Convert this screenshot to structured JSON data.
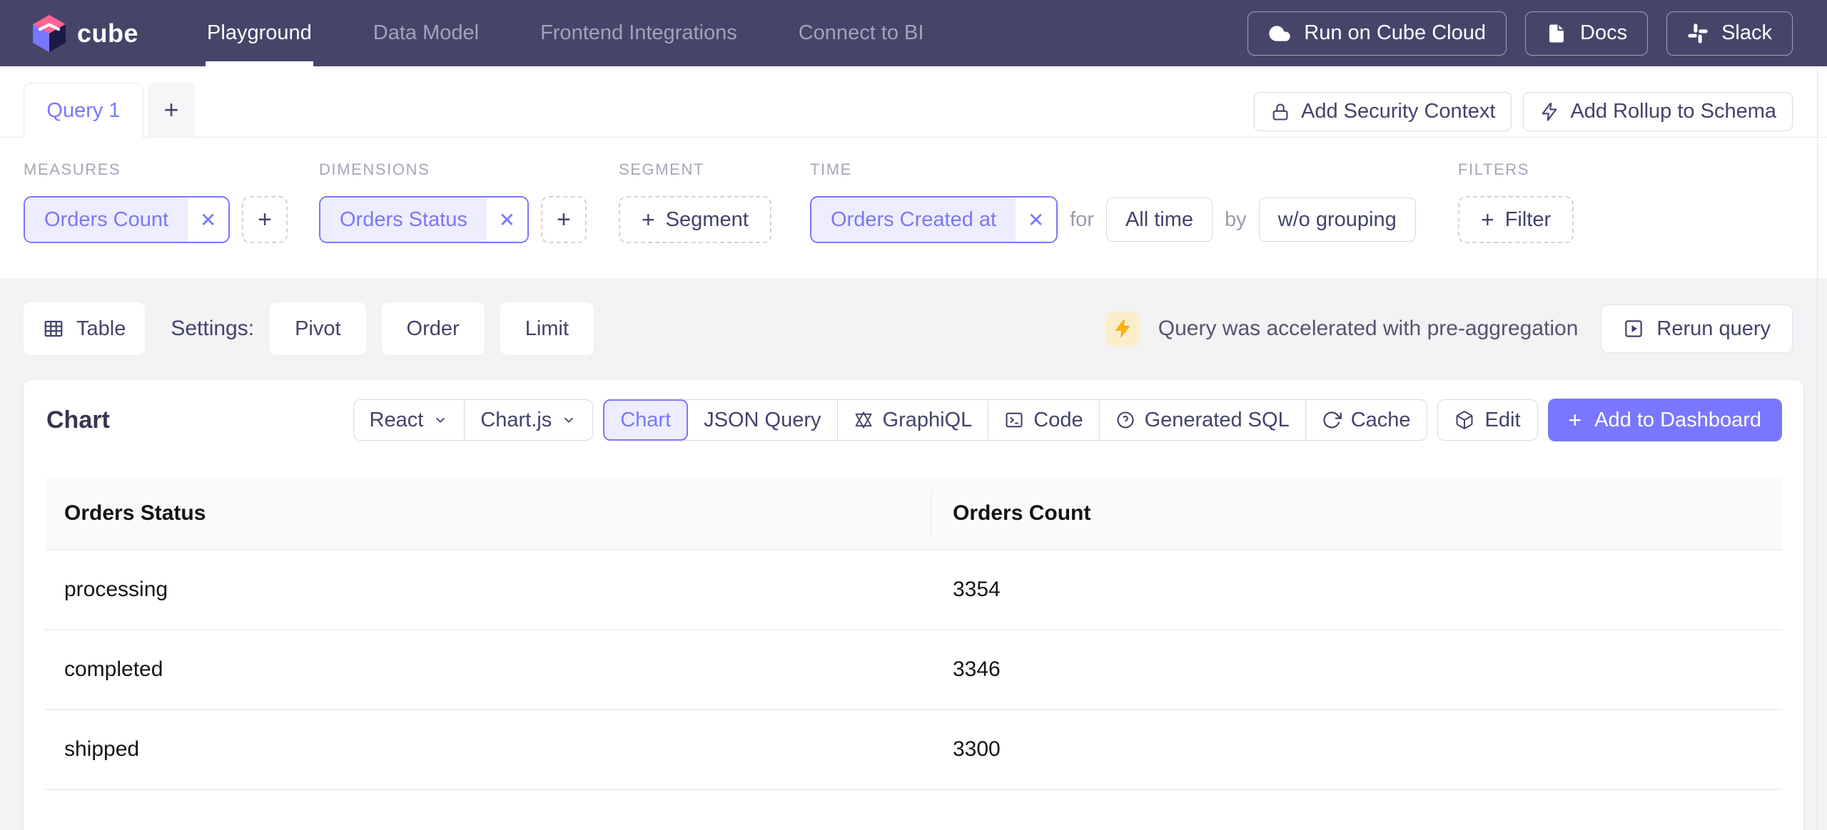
{
  "colors": {
    "nav_background": "#464569",
    "accent_purple": "#7A77FF",
    "brand_pink": "#FF6492",
    "chip_fill": "#EDEDFD",
    "warning_yellow": "#FFB300",
    "lower_background": "#f3f3f5"
  },
  "nav": {
    "brand": "cube",
    "logo_icon": "cube-logo-icon",
    "items": [
      {
        "label": "Playground",
        "active": true
      },
      {
        "label": "Data Model",
        "active": false
      },
      {
        "label": "Frontend Integrations",
        "active": false
      },
      {
        "label": "Connect to BI",
        "active": false
      }
    ],
    "actions": [
      {
        "label": "Run on Cube Cloud",
        "icon": "cloud-icon"
      },
      {
        "label": "Docs",
        "icon": "document-icon"
      },
      {
        "label": "Slack",
        "icon": "slack-icon"
      }
    ]
  },
  "tabs": {
    "query_label": "Query 1",
    "add_label": "+"
  },
  "schema_actions": [
    {
      "label": "Add Security Context",
      "icon": "lock-icon"
    },
    {
      "label": "Add Rollup to Schema",
      "icon": "lightning-outline-icon"
    }
  ],
  "builder": {
    "measures": {
      "label": "MEASURES",
      "chip": "Orders Count",
      "remove": "✕",
      "add": "+"
    },
    "dimensions": {
      "label": "DIMENSIONS",
      "chip": "Orders Status",
      "remove": "✕",
      "add": "+"
    },
    "segment": {
      "label": "SEGMENT",
      "add": "+",
      "text": "Segment"
    },
    "time": {
      "label": "TIME",
      "chip": "Orders Created at",
      "remove": "✕",
      "for_word": "for",
      "range": "All time",
      "by_word": "by",
      "grouping": "w/o grouping"
    },
    "filters": {
      "label": "FILTERS",
      "add": "+",
      "text": "Filter"
    }
  },
  "settings": {
    "chart_type": "Table",
    "label": "Settings:",
    "options": [
      "Pivot",
      "Order",
      "Limit"
    ],
    "acceleration": "Query was accelerated with pre-aggregation",
    "rerun": "Rerun query"
  },
  "panel": {
    "title": "Chart",
    "framework": "React",
    "library": "Chart.js",
    "tabs": [
      "Chart",
      "JSON Query",
      "GraphiQL",
      "Code",
      "Generated SQL",
      "Cache"
    ],
    "edit": "Edit",
    "add_plus": "+",
    "add_to_dashboard": "Add to Dashboard"
  },
  "chart_data": {
    "type": "table",
    "columns": [
      "Orders Status",
      "Orders Count"
    ],
    "rows": [
      [
        "processing",
        3354
      ],
      [
        "completed",
        3346
      ],
      [
        "shipped",
        3300
      ]
    ]
  }
}
